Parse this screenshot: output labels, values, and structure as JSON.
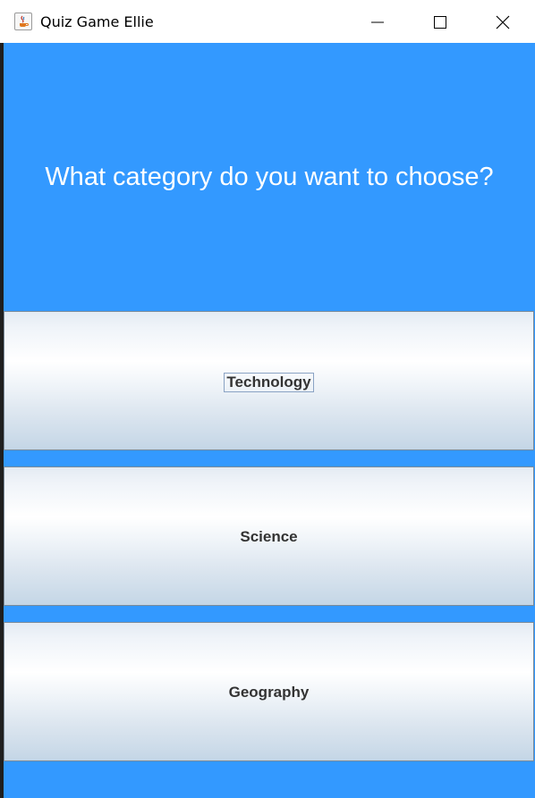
{
  "window": {
    "title": "Quiz Game Ellie",
    "app_icon": "java-coffee-cup-icon",
    "controls": [
      "minimize-icon",
      "maximize-icon",
      "close-icon"
    ]
  },
  "question": {
    "text": "What category do you want to choose?"
  },
  "categories": [
    {
      "label": "Technology",
      "focused": true
    },
    {
      "label": "Science",
      "focused": false
    },
    {
      "label": "Geography",
      "focused": false
    }
  ],
  "colors": {
    "panel_background": "#3399ff",
    "question_text": "#ffffff",
    "button_text": "#333333"
  }
}
